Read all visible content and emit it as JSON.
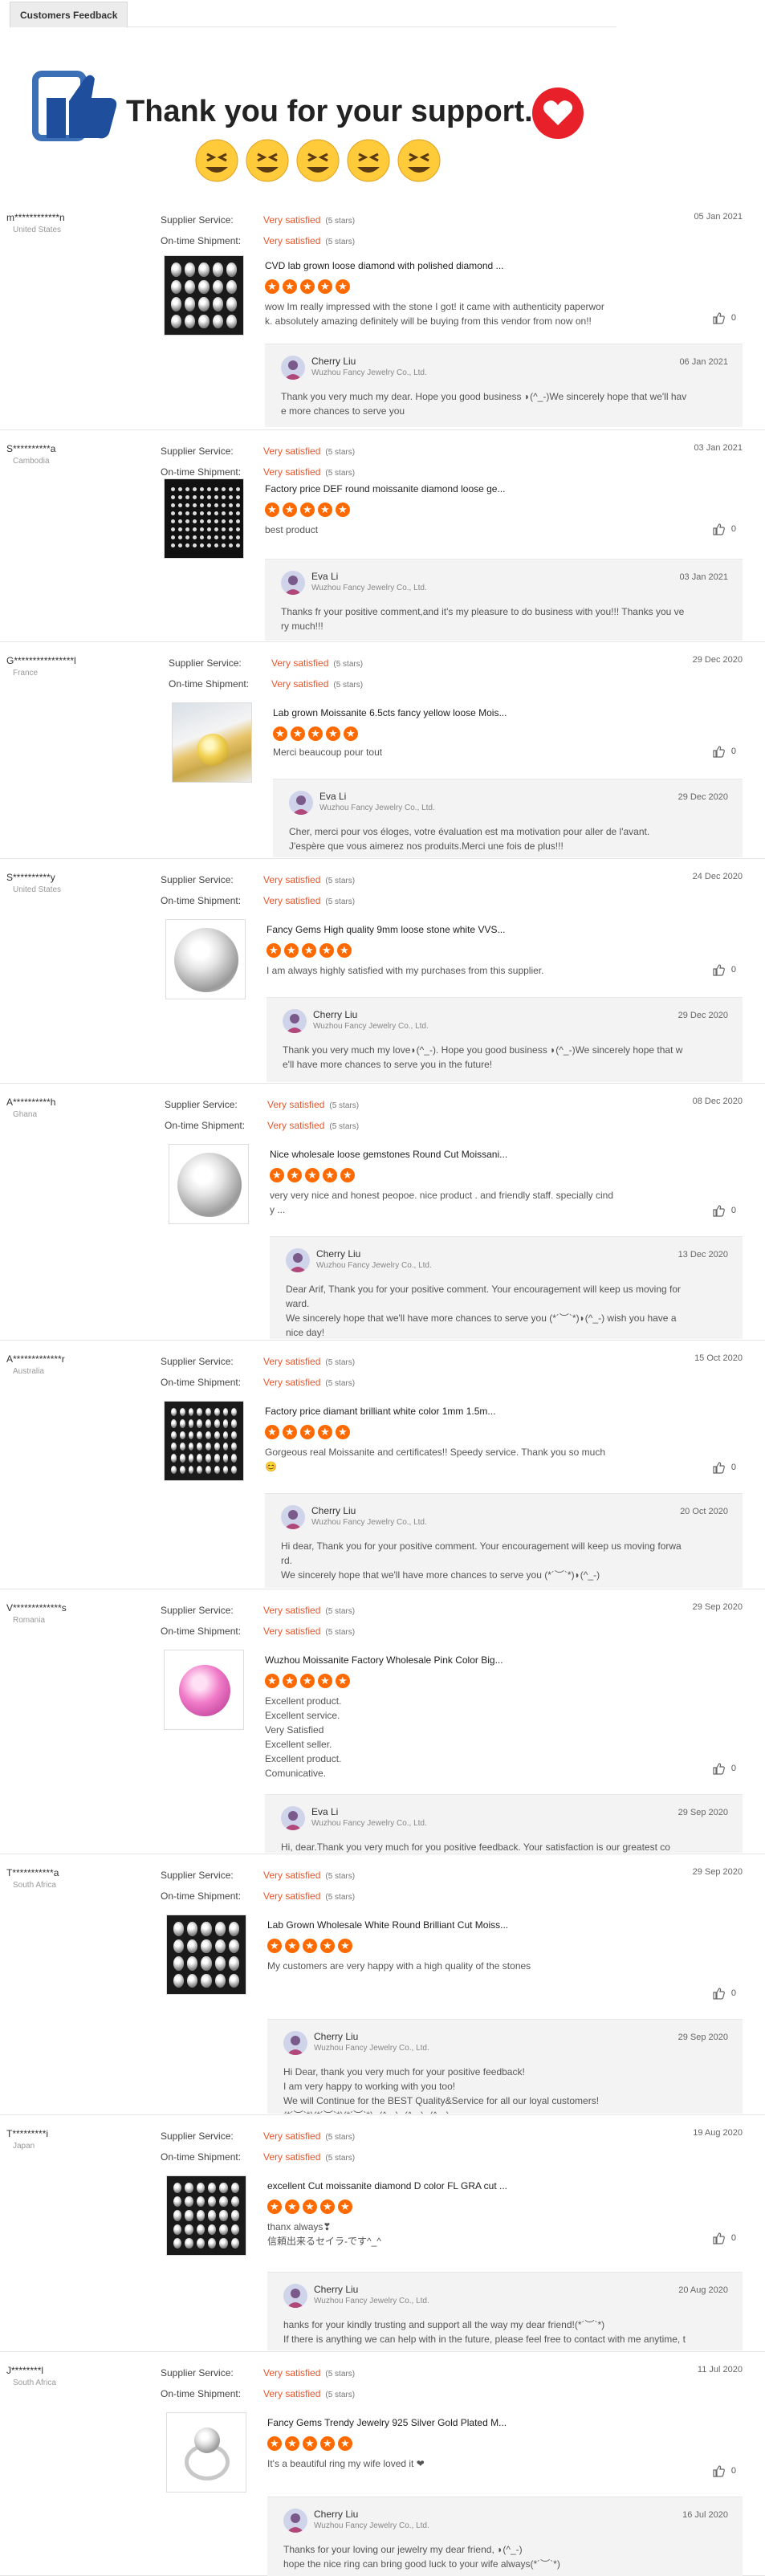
{
  "tab": {
    "label": "Customers Feedback"
  },
  "banner": {
    "text": "Thank you for your support."
  },
  "labels": {
    "supplier_service": "Supplier Service:",
    "ontime_shipment": "On-time Shipment:"
  },
  "reviews": [
    {
      "buyer": "m************n",
      "country": "United States",
      "service": "Very satisfied",
      "service_stars": "(5 stars)",
      "shipment": "Very satisfied",
      "shipment_stars": "(5 stars)",
      "date": "05 Jan 2021",
      "product": "CVD lab grown loose diamond with polished diamond ...",
      "comment": "wow Im really impressed with the stone I got! it came with authenticity paperwor\nk. absolutely amazing definitely will be buying from this vendor from now on!!",
      "likes": "0",
      "reply": {
        "name": "Cherry Liu",
        "company": "Wuzhou Fancy Jewelry Co., Ltd.",
        "date": "06 Jan 2021",
        "text": "Thank you very much my dear. Hope you good business ◗(^_-)We sincerely hope that we'll hav\ne more chances to serve you"
      }
    },
    {
      "buyer": "S**********a",
      "country": "Cambodia",
      "service": "Very satisfied",
      "service_stars": "(5 stars)",
      "shipment": "Very satisfied",
      "shipment_stars": "(5 stars)",
      "date": "03 Jan 2021",
      "product": "Factory price DEF round moissanite diamond loose ge...",
      "comment": "best product",
      "likes": "0",
      "reply": {
        "name": "Eva Li",
        "company": "Wuzhou Fancy Jewelry Co., Ltd.",
        "date": "03 Jan 2021",
        "text": "Thanks fr your positive comment,and it's my pleasure to do business with you!!! Thanks you ve\nry much!!!"
      }
    },
    {
      "buyer": "G****************l",
      "country": "France",
      "service": "Very satisfied",
      "service_stars": "(5 stars)",
      "shipment": "Very satisfied",
      "shipment_stars": "(5 stars)",
      "date": "29 Dec 2020",
      "product": "Lab grown Moissanite 6.5cts fancy yellow loose Mois...",
      "comment": "Merci beaucoup pour tout",
      "likes": "0",
      "reply": {
        "name": "Eva Li",
        "company": "Wuzhou Fancy Jewelry Co., Ltd.",
        "date": "29 Dec 2020",
        "text": "Cher, merci pour vos éloges, votre évaluation est ma motivation pour aller de l'avant.\nJ'espère que vous aimerez nos produits.Merci une fois de plus!!!"
      }
    },
    {
      "buyer": "S**********y",
      "country": "United States",
      "service": "Very satisfied",
      "service_stars": "(5 stars)",
      "shipment": "Very satisfied",
      "shipment_stars": "(5 stars)",
      "date": "24 Dec 2020",
      "product": "Fancy Gems High quality 9mm loose stone white VVS...",
      "comment": "I am always highly satisfied with my purchases from this supplier.",
      "likes": "0",
      "reply": {
        "name": "Cherry Liu",
        "company": "Wuzhou Fancy Jewelry Co., Ltd.",
        "date": "29 Dec 2020",
        "text": "Thank you very much my love◗(^_-). Hope you good business ◗(^_-)We sincerely hope that w\ne'll have more chances to serve you in the future!"
      }
    },
    {
      "buyer": "A**********h",
      "country": "Ghana",
      "service": "Very satisfied",
      "service_stars": "(5 stars)",
      "shipment": "Very satisfied",
      "shipment_stars": "(5 stars)",
      "date": "08 Dec 2020",
      "product": "Nice wholesale loose gemstones Round Cut Moissani...",
      "comment": "very very nice and honest  peopoe. nice product . and friendly staff. specially cind\ny ...",
      "likes": "0",
      "reply": {
        "name": "Cherry Liu",
        "company": "Wuzhou Fancy Jewelry Co., Ltd.",
        "date": "13 Dec 2020",
        "text": "Dear Arif, Thank you for your positive comment. Your encouragement will keep us moving for\nward.\nWe sincerely hope that we'll have more chances to serve you (*´︶`*)◗(^_-) wish you have a\nnice day!"
      }
    },
    {
      "buyer": "A*************r",
      "country": "Australia",
      "service": "Very satisfied",
      "service_stars": "(5 stars)",
      "shipment": "Very satisfied",
      "shipment_stars": "(5 stars)",
      "date": "15 Oct 2020",
      "product": "Factory price diamant brilliant white color 1mm 1.5m...",
      "comment": "Gorgeous real Moissanite and certificates!! Speedy service. Thank you so much\n😊",
      "likes": "0",
      "reply": {
        "name": "Cherry Liu",
        "company": "Wuzhou Fancy Jewelry Co., Ltd.",
        "date": "20 Oct 2020",
        "text": "Hi dear, Thank you for your positive comment. Your encouragement will keep us moving forwa\nrd.\nWe sincerely hope that we'll have more chances to serve you (*´︶`*)◗(^_-)"
      }
    },
    {
      "buyer": "V*************s",
      "country": "Romania",
      "service": "Very satisfied",
      "service_stars": "(5 stars)",
      "shipment": "Very satisfied",
      "shipment_stars": "(5 stars)",
      "date": "29 Sep 2020",
      "product": "Wuzhou Moissanite Factory Wholesale Pink Color Big...",
      "comment": "Excellent product.\nExcellent service.\nVery Satisfied\nExcellent seller.\nExcellent product.\nComunicative.",
      "likes": "0",
      "reply": {
        "name": "Eva Li",
        "company": "Wuzhou Fancy Jewelry Co., Ltd.",
        "date": "29 Sep 2020",
        "text": "Hi,  dear.Thank you very much for you positive feedback. Your satisfaction is our greatest co\nmfort and greatest return. We will redouble our efforts to do better.And wish you happy every"
      }
    },
    {
      "buyer": "T***********a",
      "country": "South Africa",
      "service": "Very satisfied",
      "service_stars": "(5 stars)",
      "shipment": "Very satisfied",
      "shipment_stars": "(5 stars)",
      "date": "29 Sep 2020",
      "product": "Lab Grown Wholesale White Round Brilliant Cut Moiss...",
      "comment": "My customers are very happy with a high quality of the stones",
      "likes": "0",
      "reply": {
        "name": "Cherry Liu",
        "company": "Wuzhou Fancy Jewelry Co., Ltd.",
        "date": "29 Sep 2020",
        "text": "Hi Dear, thank you very much for your positive feedback!\nI am very happy to working with you too!\nWe will Continue for the BEST Quality&Service for all our loyal customers!\n(*´︶`*)(*´︶`*)(*´︶`*)◗(^_-)◗(^_-)◗(^_-)"
      }
    },
    {
      "buyer": "T*********i",
      "country": "Japan",
      "service": "Very satisfied",
      "service_stars": "(5 stars)",
      "shipment": "Very satisfied",
      "shipment_stars": "(5 stars)",
      "date": "19 Aug 2020",
      "product": "excellent Cut moissanite diamond D color FL GRA cut ...",
      "comment": "thanx  always❣\n信頼出来るセイラ‐です^_^",
      "likes": "0",
      "reply": {
        "name": "Cherry Liu",
        "company": "Wuzhou Fancy Jewelry Co., Ltd.",
        "date": "20 Aug 2020",
        "text": "hanks for your kindly trusting and support all the way my dear friend!(*´︶`*)\nIf there is anything we can help with in the future, please feel free to contact with me anytime, t"
      }
    },
    {
      "buyer": "J********l",
      "country": "South Africa",
      "service": "Very satisfied",
      "service_stars": "(5 stars)",
      "shipment": "Very satisfied",
      "shipment_stars": "(5 stars)",
      "date": "11 Jul 2020",
      "product": "Fancy Gems Trendy Jewelry 925 Silver Gold Plated M...",
      "comment": "It's a beautiful ring my wife loved it ❤",
      "likes": "0",
      "reply": {
        "name": "Cherry Liu",
        "company": "Wuzhou Fancy Jewelry Co., Ltd.",
        "date": "16 Jul 2020",
        "text": "Thanks for your loving our jewelry my dear friend, ◗(^_-)\nhope the nice ring can bring good luck to your wife always(*´︶`*)"
      }
    }
  ]
}
